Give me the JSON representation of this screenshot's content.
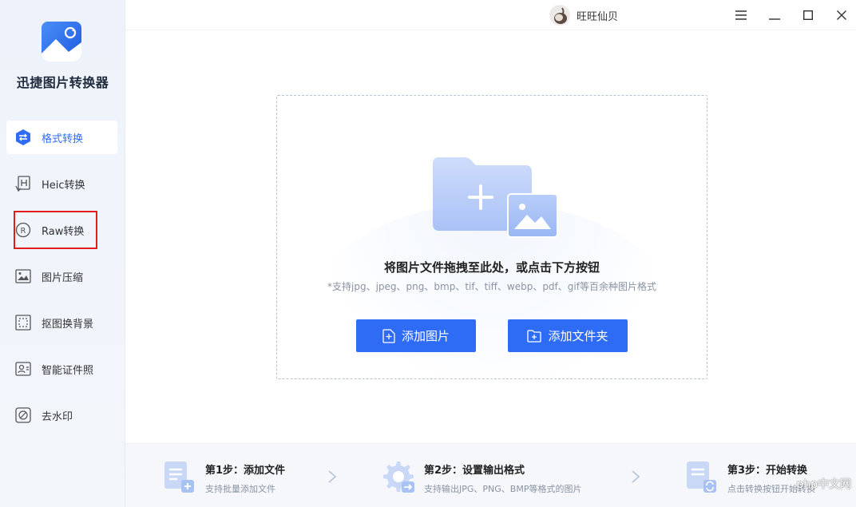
{
  "app": {
    "name": "迅捷图片转换器"
  },
  "user": {
    "name": "旺旺仙贝"
  },
  "sidebar": {
    "items": [
      {
        "label": "格式转换",
        "icon": "swap-icon",
        "active": true
      },
      {
        "label": "Heic转换",
        "icon": "heic-icon"
      },
      {
        "label": "Raw转换",
        "icon": "raw-icon"
      },
      {
        "label": "图片压缩",
        "icon": "image-compress-icon"
      },
      {
        "label": "抠图换背景",
        "icon": "cutout-icon"
      },
      {
        "label": "智能证件照",
        "icon": "id-photo-icon"
      },
      {
        "label": "去水印",
        "icon": "watermark-remove-icon"
      }
    ]
  },
  "dropzone": {
    "title": "将图片文件拖拽至此处，或点击下方按钮",
    "hint": "*支持jpg、jpeg、png、bmp、tif、tiff、webp、pdf、gif等百余种图片格式",
    "add_image_label": "添加图片",
    "add_folder_label": "添加文件夹"
  },
  "steps": [
    {
      "title": "第1步：添加文件",
      "desc": "支持批量添加文件"
    },
    {
      "title": "第2步：设置输出格式",
      "desc": "支持输出JPG、PNG、BMP等格式的图片"
    },
    {
      "title": "第3步：开始转换",
      "desc": "点击转换按钮开始转换"
    }
  ],
  "watermark": "php中文网",
  "colors": {
    "accent": "#2f6cf5",
    "highlight": "#e31b1b"
  }
}
